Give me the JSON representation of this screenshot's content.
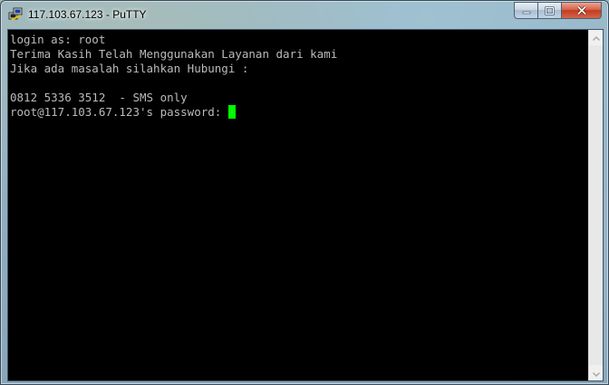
{
  "window": {
    "title": "117.103.67.123 - PuTTY",
    "icon": "putty-icon",
    "controls": {
      "minimize": "minimize-icon",
      "maximize": "maximize-icon",
      "close": "close-icon"
    }
  },
  "terminal": {
    "lines": [
      "login as: root",
      "Terima Kasih Telah Menggunakan Layanan dari kami",
      "Jika ada masalah silahkan Hubungi :",
      "",
      "0812 5336 3512  - SMS only"
    ],
    "prompt": "root@117.103.67.123's password: ",
    "foreground": "#bbbbbb",
    "background": "#000000",
    "cursor_color": "#00ff00"
  },
  "colors": {
    "close_button": "#c33b1f",
    "scrollbar": "#f0f0f0"
  }
}
